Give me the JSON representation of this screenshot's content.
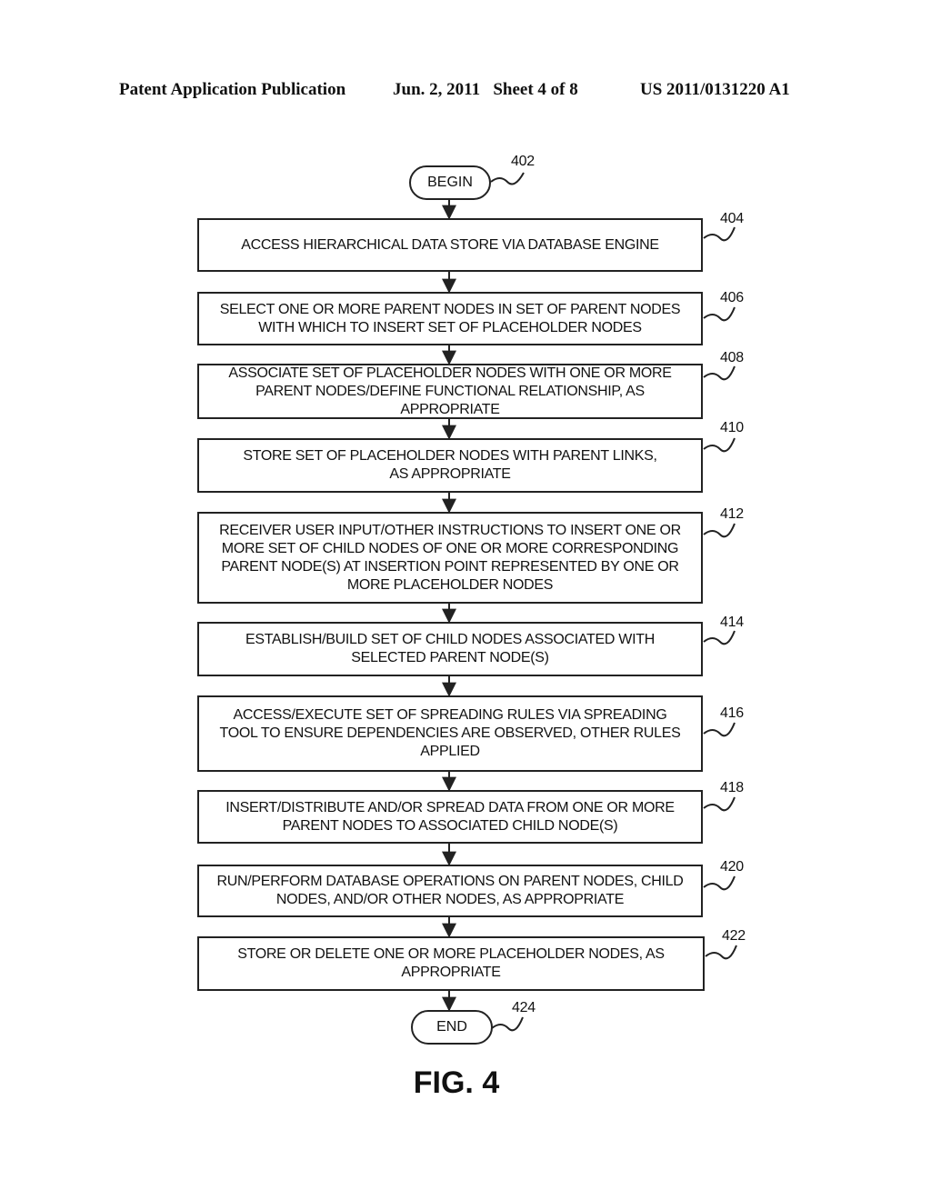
{
  "header": {
    "publication": "Patent Application Publication",
    "date_sheet": "Jun. 2, 2011   Sheet 4 of 8",
    "number": "US 2011/0131220 A1"
  },
  "flowchart": {
    "begin": {
      "label": "BEGIN",
      "ref": "402"
    },
    "steps": [
      {
        "ref": "404",
        "text": "ACCESS HIERARCHICAL DATA STORE VIA DATABASE ENGINE"
      },
      {
        "ref": "406",
        "text": "SELECT ONE OR MORE PARENT NODES IN SET OF PARENT NODES\nWITH WHICH TO INSERT SET OF PLACEHOLDER NODES"
      },
      {
        "ref": "408",
        "text": "ASSOCIATE SET OF PLACEHOLDER NODES WITH ONE OR MORE\nPARENT NODES/DEFINE FUNCTIONAL RELATIONSHIP, AS APPROPRIATE"
      },
      {
        "ref": "410",
        "text": "STORE SET OF PLACEHOLDER NODES WITH PARENT LINKS,\nAS APPROPRIATE"
      },
      {
        "ref": "412",
        "text": "RECEIVER USER INPUT/OTHER INSTRUCTIONS TO INSERT ONE OR\nMORE SET OF CHILD NODES OF ONE OR MORE CORRESPONDING\nPARENT NODE(S) AT INSERTION POINT REPRESENTED BY ONE OR\nMORE PLACEHOLDER NODES"
      },
      {
        "ref": "414",
        "text": "ESTABLISH/BUILD SET OF CHILD NODES ASSOCIATED WITH\nSELECTED PARENT NODE(S)"
      },
      {
        "ref": "416",
        "text": "ACCESS/EXECUTE SET OF SPREADING RULES VIA SPREADING\nTOOL TO ENSURE DEPENDENCIES ARE OBSERVED, OTHER RULES\nAPPLIED"
      },
      {
        "ref": "418",
        "text": "INSERT/DISTRIBUTE AND/OR SPREAD DATA FROM ONE OR MORE\nPARENT NODES TO ASSOCIATED CHILD NODE(S)"
      },
      {
        "ref": "420",
        "text": "RUN/PERFORM DATABASE OPERATIONS ON PARENT NODES, CHILD\nNODES, AND/OR OTHER NODES, AS APPROPRIATE"
      },
      {
        "ref": "422",
        "text": "STORE OR DELETE ONE OR MORE PLACEHOLDER NODES, AS\nAPPROPRIATE"
      }
    ],
    "end": {
      "label": "END",
      "ref": "424"
    }
  },
  "figure_label": "FIG. 4"
}
